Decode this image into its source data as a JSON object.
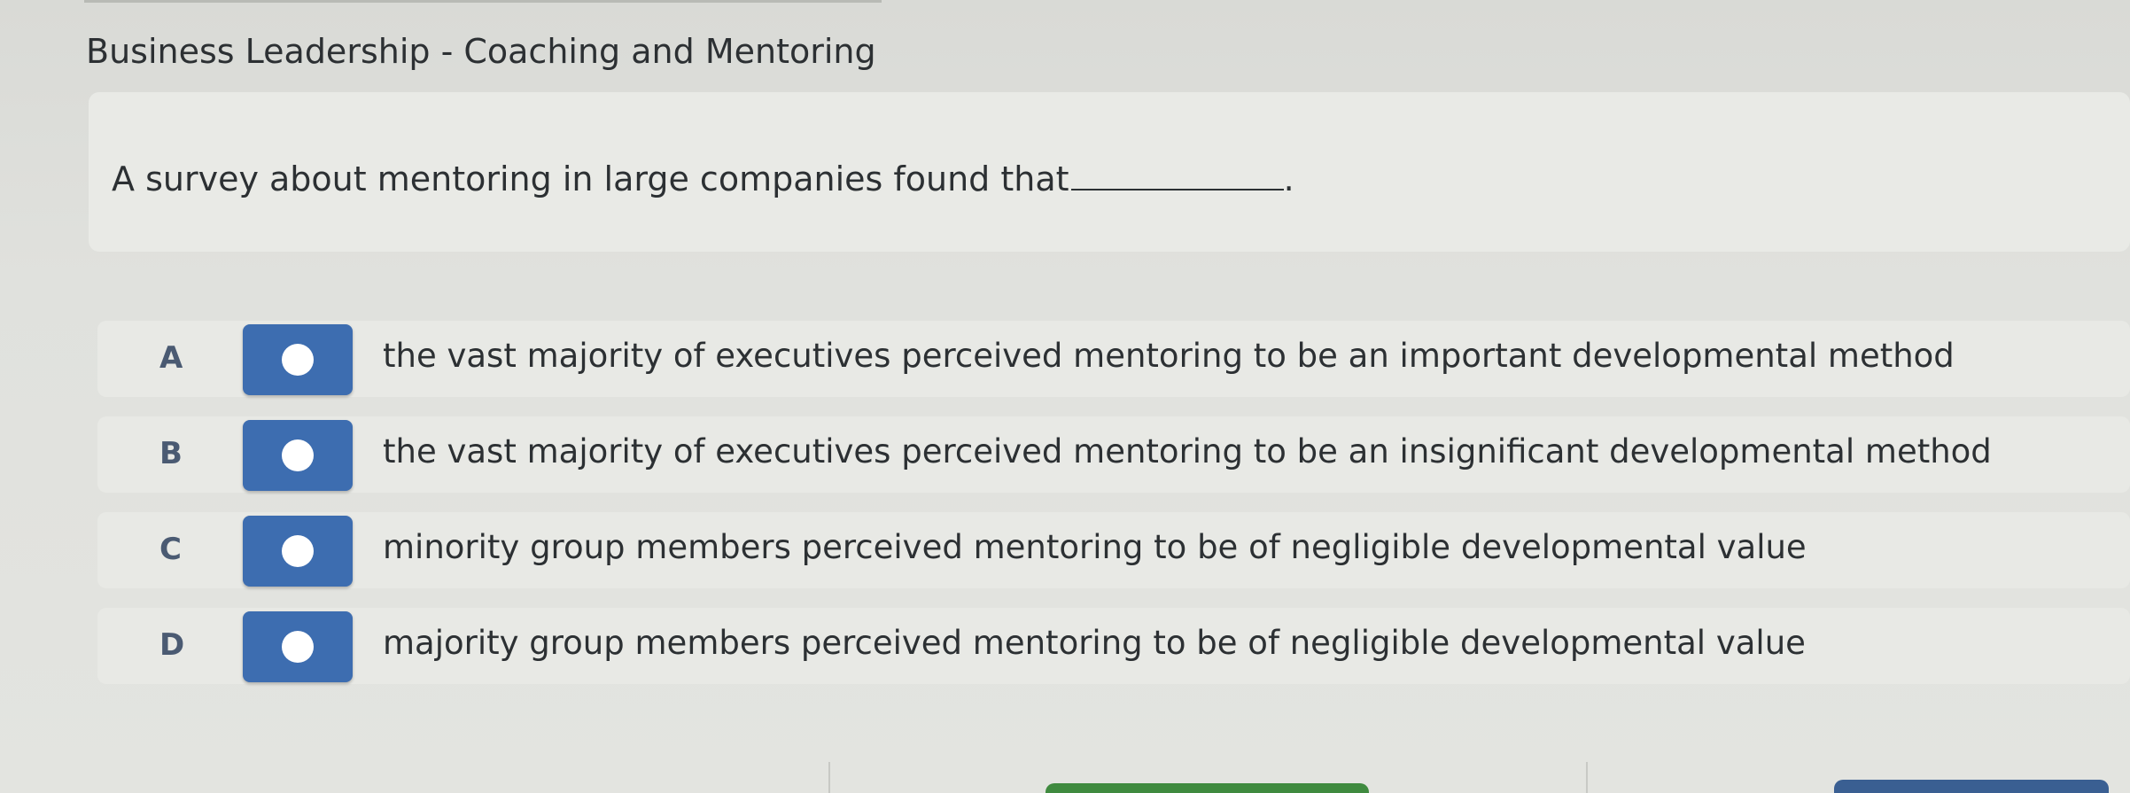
{
  "course": {
    "title": "Business Leadership - Coaching and Mentoring"
  },
  "question": {
    "text": "A survey about mentoring in large companies found that",
    "suffix": "."
  },
  "options": [
    {
      "letter": "A",
      "text": "the vast majority of executives perceived mentoring to be an important developmental method"
    },
    {
      "letter": "B",
      "text": "the vast majority of executives perceived mentoring to be an insignificant developmental method"
    },
    {
      "letter": "C",
      "text": "minority group members perceived mentoring to be of negligible developmental value"
    },
    {
      "letter": "D",
      "text": "majority group members perceived mentoring to be of negligible developmental value"
    }
  ],
  "colors": {
    "choice_button": "#3d6db0",
    "submit_button": "#3f8a3f",
    "next_button": "#3a5f92"
  }
}
